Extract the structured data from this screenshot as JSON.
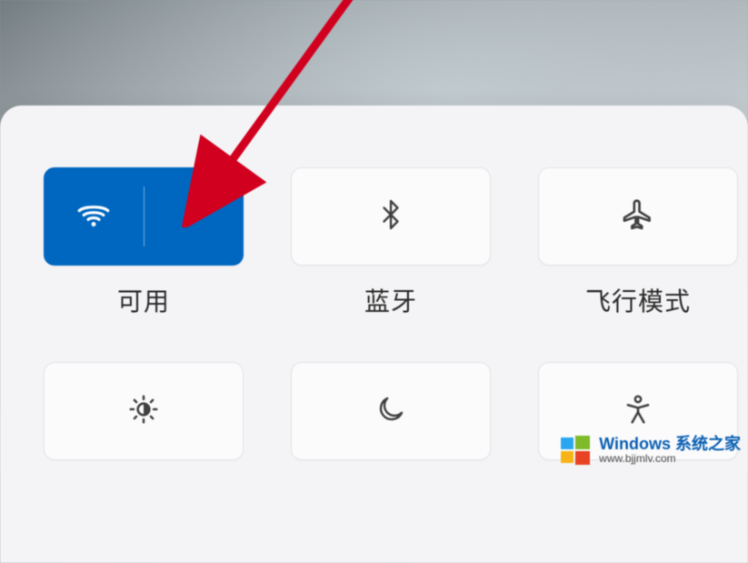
{
  "tiles": {
    "wifi": {
      "label": "可用",
      "active": true
    },
    "bluetooth": {
      "label": "蓝牙",
      "active": false
    },
    "airplane": {
      "label": "飞行模式",
      "active": false
    }
  },
  "watermark": {
    "title": "Windows 系统之家",
    "url": "www.bjjmlv.com"
  },
  "annotation": {
    "arrow_color": "#d1001f"
  }
}
